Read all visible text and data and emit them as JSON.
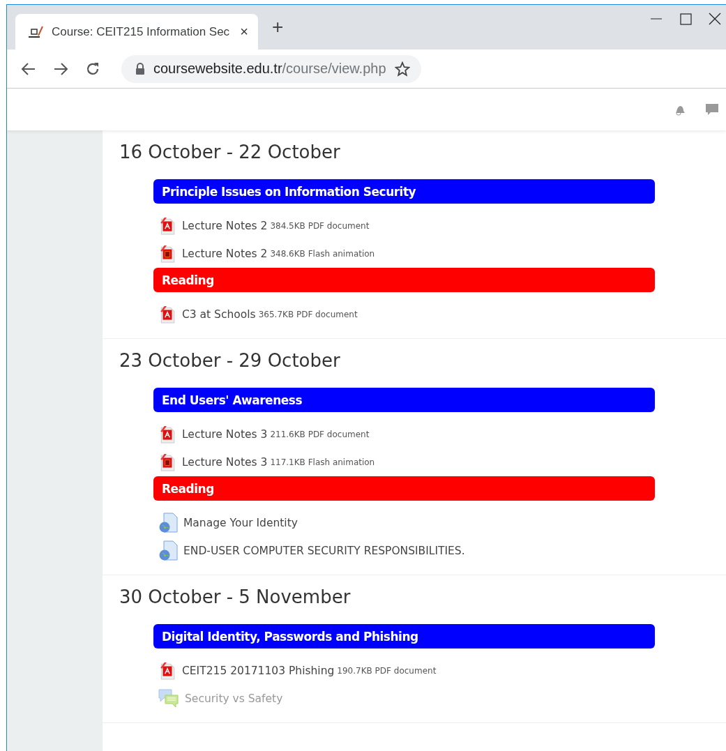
{
  "browser": {
    "tab": {
      "title": "Course: CEIT215 Information Sec",
      "selected": true,
      "close": "×"
    },
    "new_tab": "+",
    "address": {
      "host": "coursewebsite.edu.tr",
      "path": "/course/view.php"
    }
  },
  "sections": [
    {
      "title": "16 October - 22 October",
      "blocks": [
        {
          "kind": "label",
          "text": "Principle Issues on Information Security",
          "color": "#0000ff"
        },
        {
          "kind": "pdf",
          "name": "Lecture Notes 2",
          "info": "384.5KB PDF document",
          "dimmed": false
        },
        {
          "kind": "flash",
          "name": "Lecture Notes 2",
          "info": "348.6KB Flash animation",
          "dimmed": false
        },
        {
          "kind": "label",
          "text": "Reading",
          "color": "#ff0000"
        },
        {
          "kind": "pdf",
          "name": "C3 at Schools",
          "info": "365.7KB PDF document",
          "dimmed": false
        }
      ]
    },
    {
      "title": "23 October - 29 October",
      "blocks": [
        {
          "kind": "label",
          "text": "End Users' Awareness",
          "color": "#0000ff"
        },
        {
          "kind": "pdf",
          "name": "Lecture Notes 3",
          "info": "211.6KB PDF document",
          "dimmed": false
        },
        {
          "kind": "flash",
          "name": "Lecture Notes 3",
          "info": "117.1KB Flash animation",
          "dimmed": false
        },
        {
          "kind": "label",
          "text": "Reading",
          "color": "#ff0000"
        },
        {
          "kind": "url",
          "name": "Manage Your Identity",
          "dimmed": false
        },
        {
          "kind": "url",
          "name": "END-USER COMPUTER SECURITY RESPONSIBILITIES.",
          "dimmed": false
        }
      ]
    },
    {
      "title": "30 October - 5 November",
      "blocks": [
        {
          "kind": "label",
          "text": "Digital Identity, Passwords and Phishing",
          "color": "#0000ff"
        },
        {
          "kind": "pdf",
          "name": "CEIT215 20171103 Phishing",
          "info": "190.7KB PDF document",
          "dimmed": false
        },
        {
          "kind": "forum",
          "name": "Security vs Safety",
          "dimmed": true
        }
      ]
    }
  ]
}
